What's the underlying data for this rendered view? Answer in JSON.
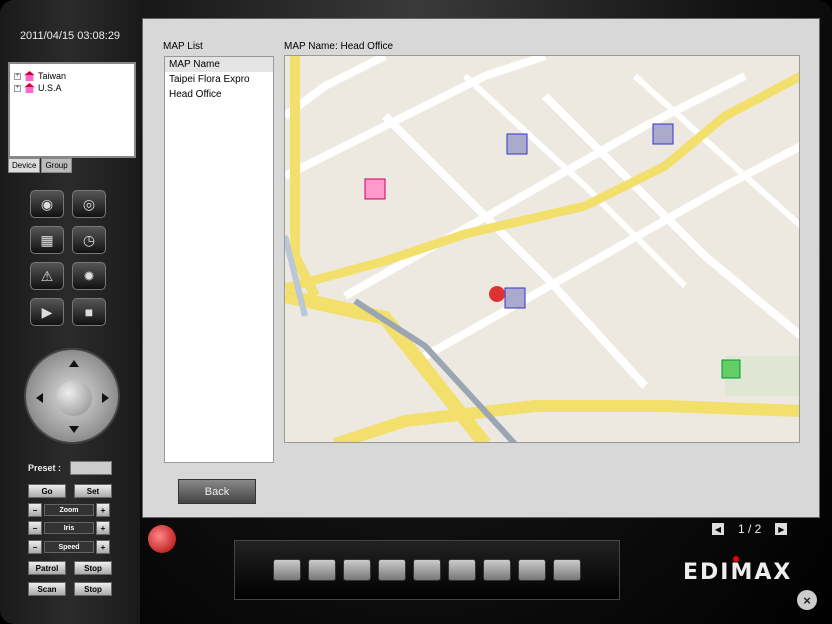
{
  "datetime": "2011/04/15 03:08:29",
  "device_tree": [
    {
      "label": "Taiwan"
    },
    {
      "label": "U.S.A"
    }
  ],
  "tabs": {
    "device": "Device",
    "group": "Group"
  },
  "ptz": {
    "preset_label": "Preset :",
    "go": "Go",
    "set": "Set",
    "zoom": "Zoom",
    "iris": "Iris",
    "speed": "Speed",
    "minus": "−",
    "plus": "+",
    "patrol": "Patrol",
    "stop1": "Stop",
    "scan": "Scan",
    "stop2": "Stop"
  },
  "maplist": {
    "label": "MAP List",
    "items": [
      "MAP Name",
      "Taipei Flora Expro",
      "Head Office"
    ]
  },
  "map_name": "MAP Name: Head Office",
  "back_label": "Back",
  "pager": "1 / 2",
  "logo": "EDIMAX",
  "close": "×"
}
